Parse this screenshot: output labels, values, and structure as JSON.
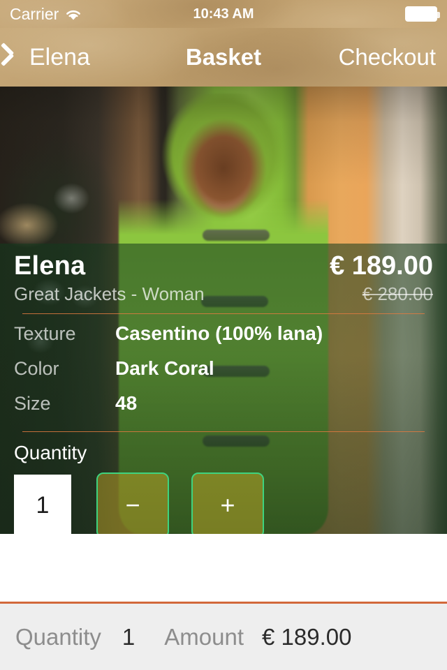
{
  "status_bar": {
    "carrier": "Carrier",
    "wifi_icon": "wifi-icon",
    "time": "10:43 AM",
    "battery_icon": "battery-full-icon"
  },
  "nav_bar": {
    "back_icon": "chevron-left-icon",
    "back_label": "Elena",
    "title": "Basket",
    "action_label": "Checkout"
  },
  "product": {
    "image_alt": "woman-in-green-hooded-coat",
    "name": "Elena",
    "subtitle": "Great Jackets - Woman",
    "price": "€ 189.00",
    "old_price": "€ 280.00",
    "attributes": [
      {
        "label": "Texture",
        "value": "Casentino (100% lana)"
      },
      {
        "label": "Color",
        "value": "Dark Coral"
      },
      {
        "label": "Size",
        "value": "48"
      }
    ],
    "quantity_label": "Quantity",
    "quantity_value": "1",
    "decrement_label": "−",
    "increment_label": "+"
  },
  "summary": {
    "quantity_label": "Quantity",
    "quantity_value": "1",
    "amount_label": "Amount",
    "amount_value": "€ 189.00"
  },
  "colors": {
    "navbar_tan": "#c4a474",
    "divider_orange": "#e27a40",
    "summary_border": "#d2683a",
    "summary_bg": "#eeeeee",
    "stepper_border_green": "#3ed37e",
    "coat_green": "#8cc63f"
  }
}
